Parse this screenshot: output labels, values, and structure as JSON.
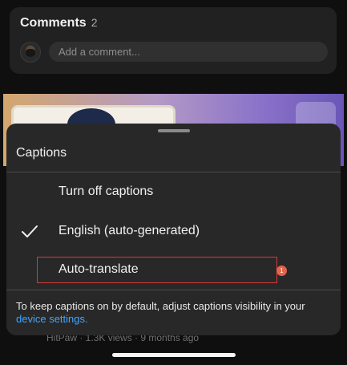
{
  "comments": {
    "title": "Comments",
    "count": "2",
    "input_placeholder": "Add a comment..."
  },
  "video_meta": {
    "text": "HitPaw · 1.3K views · 9 months ago"
  },
  "captions_sheet": {
    "title": "Captions",
    "options": [
      {
        "label": "Turn off captions",
        "selected": false
      },
      {
        "label": "English (auto-generated)",
        "selected": true
      },
      {
        "label": "Auto-translate",
        "selected": false
      }
    ],
    "annotation_badge": "1",
    "footer_prefix": "To keep captions on by default, adjust captions visibility in your",
    "footer_link": "device settings.",
    "colors": {
      "link": "#3ea6ff",
      "highlight": "#d43b3b",
      "badge": "#e5634d"
    }
  }
}
